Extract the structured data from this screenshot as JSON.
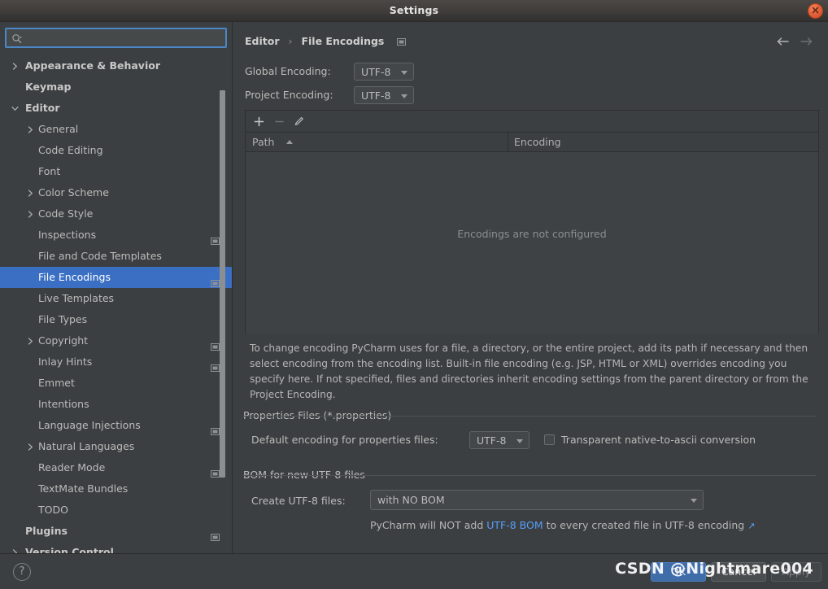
{
  "window": {
    "title": "Settings",
    "close_icon": "close-icon"
  },
  "search": {
    "value": "",
    "placeholder": "",
    "icon": "search-icon"
  },
  "sidebar": {
    "items": [
      {
        "label": "Appearance & Behavior",
        "level": 0,
        "expandable": true,
        "expanded": false,
        "badge": false,
        "selected": false
      },
      {
        "label": "Keymap",
        "level": 0,
        "expandable": false,
        "expanded": false,
        "badge": false,
        "selected": false
      },
      {
        "label": "Editor",
        "level": 0,
        "expandable": true,
        "expanded": true,
        "badge": false,
        "selected": false
      },
      {
        "label": "General",
        "level": 1,
        "expandable": true,
        "expanded": false,
        "badge": false,
        "selected": false
      },
      {
        "label": "Code Editing",
        "level": 1,
        "expandable": false,
        "expanded": false,
        "badge": false,
        "selected": false
      },
      {
        "label": "Font",
        "level": 1,
        "expandable": false,
        "expanded": false,
        "badge": false,
        "selected": false
      },
      {
        "label": "Color Scheme",
        "level": 1,
        "expandable": true,
        "expanded": false,
        "badge": false,
        "selected": false
      },
      {
        "label": "Code Style",
        "level": 1,
        "expandable": true,
        "expanded": false,
        "badge": false,
        "selected": false
      },
      {
        "label": "Inspections",
        "level": 1,
        "expandable": false,
        "expanded": false,
        "badge": true,
        "selected": false
      },
      {
        "label": "File and Code Templates",
        "level": 1,
        "expandable": false,
        "expanded": false,
        "badge": false,
        "selected": false
      },
      {
        "label": "File Encodings",
        "level": 1,
        "expandable": false,
        "expanded": false,
        "badge": true,
        "selected": true
      },
      {
        "label": "Live Templates",
        "level": 1,
        "expandable": false,
        "expanded": false,
        "badge": false,
        "selected": false
      },
      {
        "label": "File Types",
        "level": 1,
        "expandable": false,
        "expanded": false,
        "badge": false,
        "selected": false
      },
      {
        "label": "Copyright",
        "level": 1,
        "expandable": true,
        "expanded": false,
        "badge": true,
        "selected": false
      },
      {
        "label": "Inlay Hints",
        "level": 1,
        "expandable": false,
        "expanded": false,
        "badge": true,
        "selected": false
      },
      {
        "label": "Emmet",
        "level": 1,
        "expandable": false,
        "expanded": false,
        "badge": false,
        "selected": false
      },
      {
        "label": "Intentions",
        "level": 1,
        "expandable": false,
        "expanded": false,
        "badge": false,
        "selected": false
      },
      {
        "label": "Language Injections",
        "level": 1,
        "expandable": false,
        "expanded": false,
        "badge": true,
        "selected": false
      },
      {
        "label": "Natural Languages",
        "level": 1,
        "expandable": true,
        "expanded": false,
        "badge": false,
        "selected": false
      },
      {
        "label": "Reader Mode",
        "level": 1,
        "expandable": false,
        "expanded": false,
        "badge": true,
        "selected": false
      },
      {
        "label": "TextMate Bundles",
        "level": 1,
        "expandable": false,
        "expanded": false,
        "badge": false,
        "selected": false
      },
      {
        "label": "TODO",
        "level": 1,
        "expandable": false,
        "expanded": false,
        "badge": false,
        "selected": false
      },
      {
        "label": "Plugins",
        "level": 0,
        "expandable": false,
        "expanded": false,
        "badge": true,
        "selected": false
      },
      {
        "label": "Version Control",
        "level": 0,
        "expandable": true,
        "expanded": false,
        "badge": true,
        "selected": false
      }
    ]
  },
  "panel": {
    "breadcrumb": {
      "parent": "Editor",
      "separator": "›",
      "current": "File Encodings",
      "scope_badge_icon": "project-scope-icon"
    },
    "nav": {
      "back_icon": "arrow-left-icon",
      "forward_icon": "arrow-right-icon"
    },
    "global_encoding": {
      "label": "Global Encoding:",
      "value": "UTF-8"
    },
    "project_encoding": {
      "label": "Project Encoding:",
      "value": "UTF-8"
    },
    "table": {
      "toolbar": {
        "add_icon": "plus-icon",
        "remove_icon": "minus-icon",
        "edit_icon": "pencil-icon"
      },
      "columns": [
        "Path",
        "Encoding"
      ],
      "sort_column": "Path",
      "sort_direction": "ascending",
      "rows": [],
      "empty_message": "Encodings are not configured"
    },
    "help_text": "To change encoding PyCharm uses for a file, a directory, or the entire project, add its path if necessary and then select encoding from the encoding list. Built-in file encoding (e.g. JSP, HTML or XML) overrides encoding you specify here. If not specified, files and directories inherit encoding settings from the parent directory or from the Project Encoding.",
    "properties_group": {
      "title": "Properties Files (*.properties)",
      "default_encoding_label": "Default encoding for properties files:",
      "default_encoding_value": "UTF-8",
      "transparent_checkbox_label": "Transparent native-to-ascii conversion",
      "transparent_checkbox_checked": false
    },
    "bom_group": {
      "title": "BOM for new UTF-8 files",
      "create_label": "Create UTF-8 files:",
      "create_value": "with NO BOM",
      "hint_before": "PyCharm will NOT add ",
      "hint_link": "UTF-8 BOM",
      "hint_after": " to every created file in UTF-8 encoding",
      "hint_external_icon": "↗"
    }
  },
  "bottom": {
    "help_icon": "?",
    "ok_label": "OK",
    "cancel_label": "Cancel",
    "apply_label": "Apply"
  },
  "watermark": {
    "text": "CSDN @Nightmare004"
  },
  "colors": {
    "accent_blue": "#3a6fc4",
    "link_blue": "#589df6",
    "panel_bg": "#3c3f41",
    "table_bg": "#3f4244",
    "close_red": "#e2613a"
  }
}
